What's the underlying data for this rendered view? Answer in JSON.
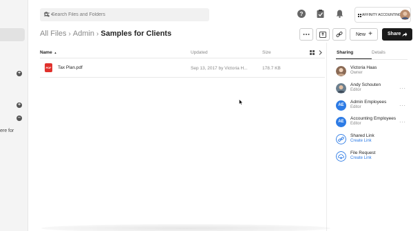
{
  "search": {
    "placeholder": "Search Files and Folders"
  },
  "account": {
    "label": "AFFINITY ACCOUNTING"
  },
  "sidebar": {
    "partial_text": "ere for"
  },
  "breadcrumb": {
    "items": [
      "All Files",
      "Admin"
    ],
    "current": "Samples for Clients"
  },
  "actions": {
    "new_label": "New",
    "new_symbol": "+",
    "share_label": "Share"
  },
  "table": {
    "headers": {
      "name": "Name",
      "name_sort": "▲",
      "updated": "Updated",
      "size": "Size"
    },
    "rows": [
      {
        "icon": "PDF",
        "name": "Tax Plan.pdf",
        "updated": "Sep 13, 2017 by Victoria H...",
        "size": "178.7 KB"
      }
    ]
  },
  "panel": {
    "tabs": [
      "Sharing",
      "Details"
    ],
    "items": [
      {
        "name": "Victoria Haas",
        "role": "Owner"
      },
      {
        "name": "Andy Schouten",
        "role": "Editor"
      },
      {
        "initials": "AE",
        "name": "Admin Employees",
        "role": "Editor"
      },
      {
        "initials": "AE",
        "name": "Accounting Employees",
        "role": "Editor"
      },
      {
        "name": "Shared Link",
        "action": "Create Link"
      },
      {
        "name": "File Request",
        "action": "Create Link"
      }
    ],
    "more_symbol": "···"
  },
  "colors": {
    "accent": "#2d7be5",
    "share_button": "#1a1a1a",
    "pdf": "#e0312c"
  }
}
